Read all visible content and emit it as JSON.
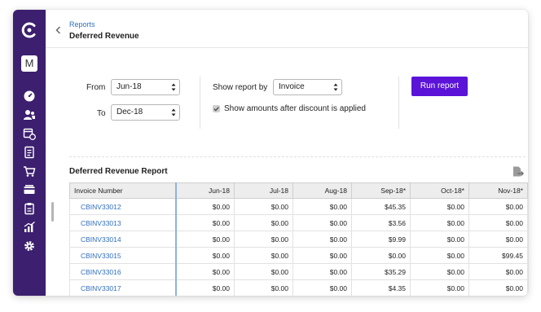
{
  "breadcrumb": "Reports",
  "page_title": "Deferred Revenue",
  "workspace_initial": "M",
  "filters": {
    "from_label": "From",
    "from_value": "Jun-18",
    "to_label": "To",
    "to_value": "Dec-18",
    "show_report_by_label": "Show report by",
    "show_report_by_value": "Invoice",
    "discount_checkbox_label": "Show amounts after discount is applied",
    "discount_checked": true,
    "run_button": "Run report"
  },
  "report": {
    "title": "Deferred Revenue Report",
    "columns": [
      "Invoice Number",
      "Jun-18",
      "Jul-18",
      "Aug-18",
      "Sep-18*",
      "Oct-18*",
      "Nov-18*"
    ],
    "rows": [
      [
        "CBINV33012",
        "$0.00",
        "$0.00",
        "$0.00",
        "$45.35",
        "$0.00",
        "$0.00"
      ],
      [
        "CBINV33013",
        "$0.00",
        "$0.00",
        "$0.00",
        "$3.56",
        "$0.00",
        "$0.00"
      ],
      [
        "CBINV33014",
        "$0.00",
        "$0.00",
        "$0.00",
        "$9.99",
        "$0.00",
        "$0.00"
      ],
      [
        "CBINV33015",
        "$0.00",
        "$0.00",
        "$0.00",
        "$0.00",
        "$0.00",
        "$99.45"
      ],
      [
        "CBINV33016",
        "$0.00",
        "$0.00",
        "$0.00",
        "$35.29",
        "$0.00",
        "$0.00"
      ],
      [
        "CBINV33017",
        "$0.00",
        "$0.00",
        "$0.00",
        "$4.35",
        "$0.00",
        "$0.00"
      ]
    ]
  },
  "sidebar_icons": [
    "dashboard-icon",
    "customers-icon",
    "subscriptions-icon",
    "invoices-icon",
    "products-icon",
    "payments-icon",
    "clipboard-icon",
    "reports-icon",
    "settings-icon"
  ],
  "colors": {
    "sidebar": "#3c1f6e",
    "primary_button": "#5b13d8",
    "link": "#2f6fbf"
  }
}
